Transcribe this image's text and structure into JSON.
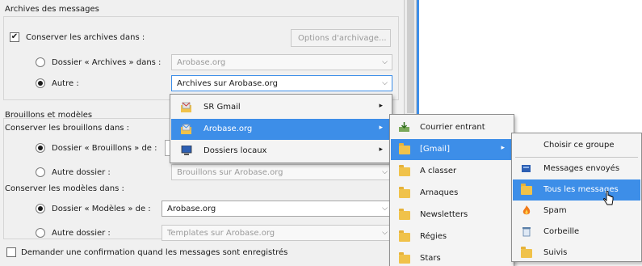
{
  "archives": {
    "legend": "Archives des messages",
    "keep_label": "Conserver les archives dans :",
    "options_button": "Options d'archivage...",
    "folder_radio_label": "Dossier « Archives » dans :",
    "folder_value": "Arobase.org",
    "other_radio_label": "Autre :",
    "other_value": "Archives sur Arobase.org"
  },
  "drafts": {
    "legend": "Brouillons et modèles",
    "keep_drafts_label": "Conserver les brouillons dans :",
    "drafts_folder_radio_label": "Dossier « Brouillons » de :",
    "other_folder_radio_label": "Autre dossier :",
    "other_folder_value": "Brouillons sur Arobase.org",
    "keep_templates_label": "Conserver les modèles dans :",
    "templates_folder_radio_label": "Dossier « Modèles » de :",
    "templates_folder_value": "Arobase.org",
    "other_folder2_radio_label": "Autre dossier :",
    "other_folder2_value": "Templates sur Arobase.org"
  },
  "confirm_label": "Demander une confirmation quand les messages sont enregistrés",
  "menu1": {
    "items": [
      "SR Gmail",
      "Arobase.org",
      "Dossiers locaux"
    ]
  },
  "menu2": {
    "items": [
      "Courrier entrant",
      "[Gmail]",
      "A classer",
      "Arnaques",
      "Newsletters",
      "Régies",
      "Stars"
    ]
  },
  "menu3": {
    "items": [
      "Choisir ce groupe",
      "Messages envoyés",
      "Tous les messages",
      "Spam",
      "Corbeille",
      "Suivis"
    ]
  },
  "icons": {
    "submenu": "▸",
    "dropdown": "⌵",
    "check": "✔"
  },
  "colors": {
    "selection": "#3d8ee8",
    "folder": "#f0c24a"
  }
}
